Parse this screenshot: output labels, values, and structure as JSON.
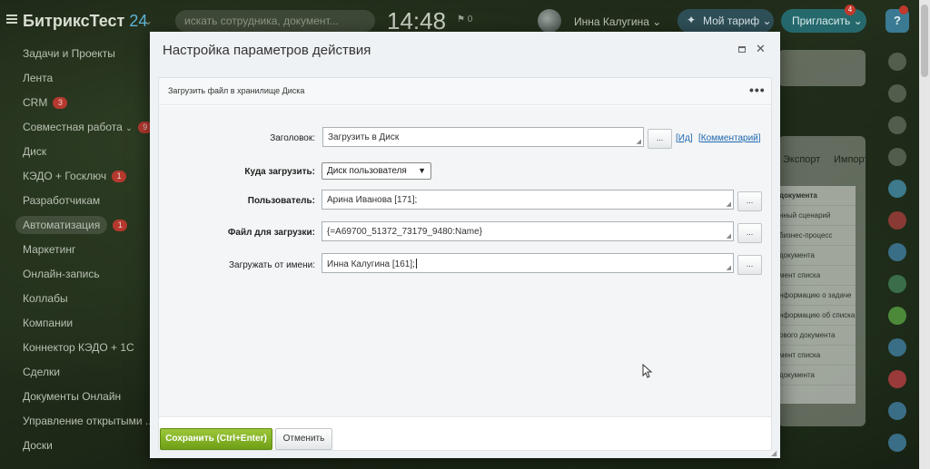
{
  "header": {
    "logo": "БитриксТест",
    "logo_num": "24",
    "search_placeholder": "искать сотрудника, документ...",
    "clock": "14:48",
    "clock_badge": "0",
    "user_name": "Инна Калугина",
    "tariff_label": "Мой тариф",
    "invite_label": "Пригласить",
    "invite_badge": "4",
    "help_label": "?"
  },
  "menu": {
    "items": [
      {
        "label": "Задачи и Проекты",
        "badge": ""
      },
      {
        "label": "Лента",
        "badge": ""
      },
      {
        "label": "CRM",
        "badge": "3"
      },
      {
        "label": "Совместная работа",
        "badge": "9"
      },
      {
        "label": "Диск",
        "badge": ""
      },
      {
        "label": "КЭДО + Госключ",
        "badge": "1"
      },
      {
        "label": "Разработчикам",
        "badge": ""
      },
      {
        "label": "Автоматизация",
        "badge": "1"
      },
      {
        "label": "Маркетинг",
        "badge": ""
      },
      {
        "label": "Онлайн-запись",
        "badge": ""
      },
      {
        "label": "Коллабы",
        "badge": ""
      },
      {
        "label": "Компании",
        "badge": ""
      },
      {
        "label": "Коннектор КЭДО + 1С",
        "badge": ""
      },
      {
        "label": "Сделки",
        "badge": ""
      },
      {
        "label": "Документы Онлайн",
        "badge": ""
      },
      {
        "label": "Управление открытыми ...",
        "badge": ""
      },
      {
        "label": "Доски",
        "badge": ""
      }
    ]
  },
  "background": {
    "tabs": [
      "Экспорт",
      "Импорт"
    ],
    "list_header": "документа",
    "rows": [
      "нный сценарий",
      "бизнес-процесс",
      "документа",
      "мент списка",
      "нформацию о задаче",
      "нформацию об списка",
      "ового документа",
      "мент списка",
      "документа"
    ]
  },
  "modal": {
    "title": "Настройка параметров действия",
    "section_title": "Загрузить файл в хранилище Диска",
    "fields": {
      "title_label": "Заголовок:",
      "title_value": "Загрузить в Диск",
      "id_link": "Ид",
      "comment_link": "Комментарий",
      "dest_label": "Куда загрузить:",
      "dest_value": "Диск пользователя",
      "user_label": "Пользователь:",
      "user_value": "Арина Иванова [171];",
      "file_label": "Файл для загрузки:",
      "file_value": "{=A69700_51372_73179_9480:Name}",
      "from_label": "Загружать от имени:",
      "from_value": "Инна Калугина [161];"
    },
    "dots_button": "...",
    "section_menu": "•••",
    "save_button": "Сохранить (Ctrl+Enter)",
    "cancel_button": "Отменить"
  },
  "colors": {
    "accent_green": "#7fb22a",
    "link_blue": "#2067b0",
    "badge_red": "#b5392e"
  }
}
